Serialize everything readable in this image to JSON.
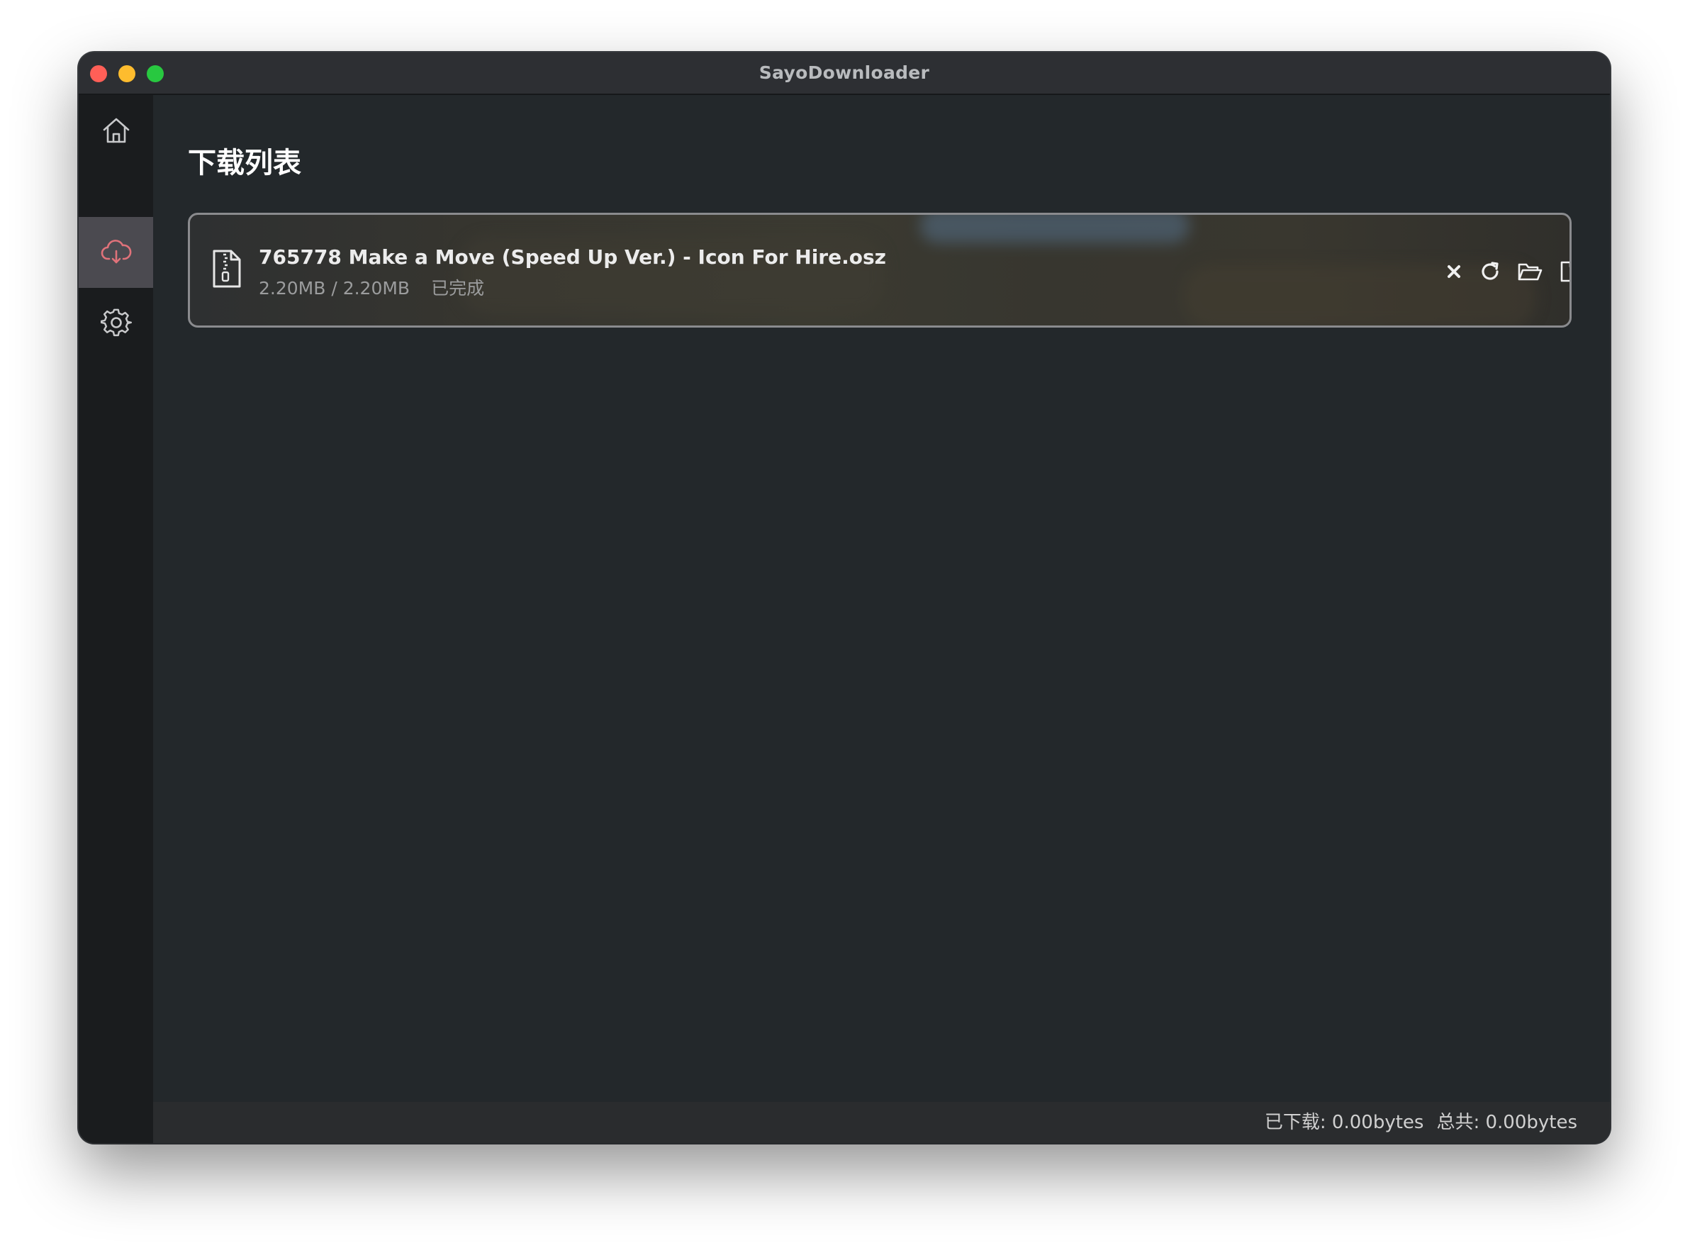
{
  "window": {
    "title": "SayoDownloader"
  },
  "sidebar": {
    "items": [
      {
        "name": "home",
        "icon": "home-icon",
        "active": false
      },
      {
        "name": "downloads",
        "icon": "cloud-download-icon",
        "active": true
      },
      {
        "name": "settings",
        "icon": "gear-icon",
        "active": false
      }
    ],
    "active_color": "#e0727a"
  },
  "main": {
    "title": "下载列表",
    "downloads": [
      {
        "file_icon": "zip-file-icon",
        "name": "765778 Make a Move (Speed Up Ver.) - Icon For Hire.osz",
        "size": "2.20MB / 2.20MB",
        "status": "已完成",
        "actions": [
          "close-icon",
          "retry-icon",
          "folder-open-icon",
          "file-icon"
        ]
      }
    ]
  },
  "statusbar": {
    "downloaded": "已下载: 0.00bytes",
    "total": "总共: 0.00bytes"
  }
}
